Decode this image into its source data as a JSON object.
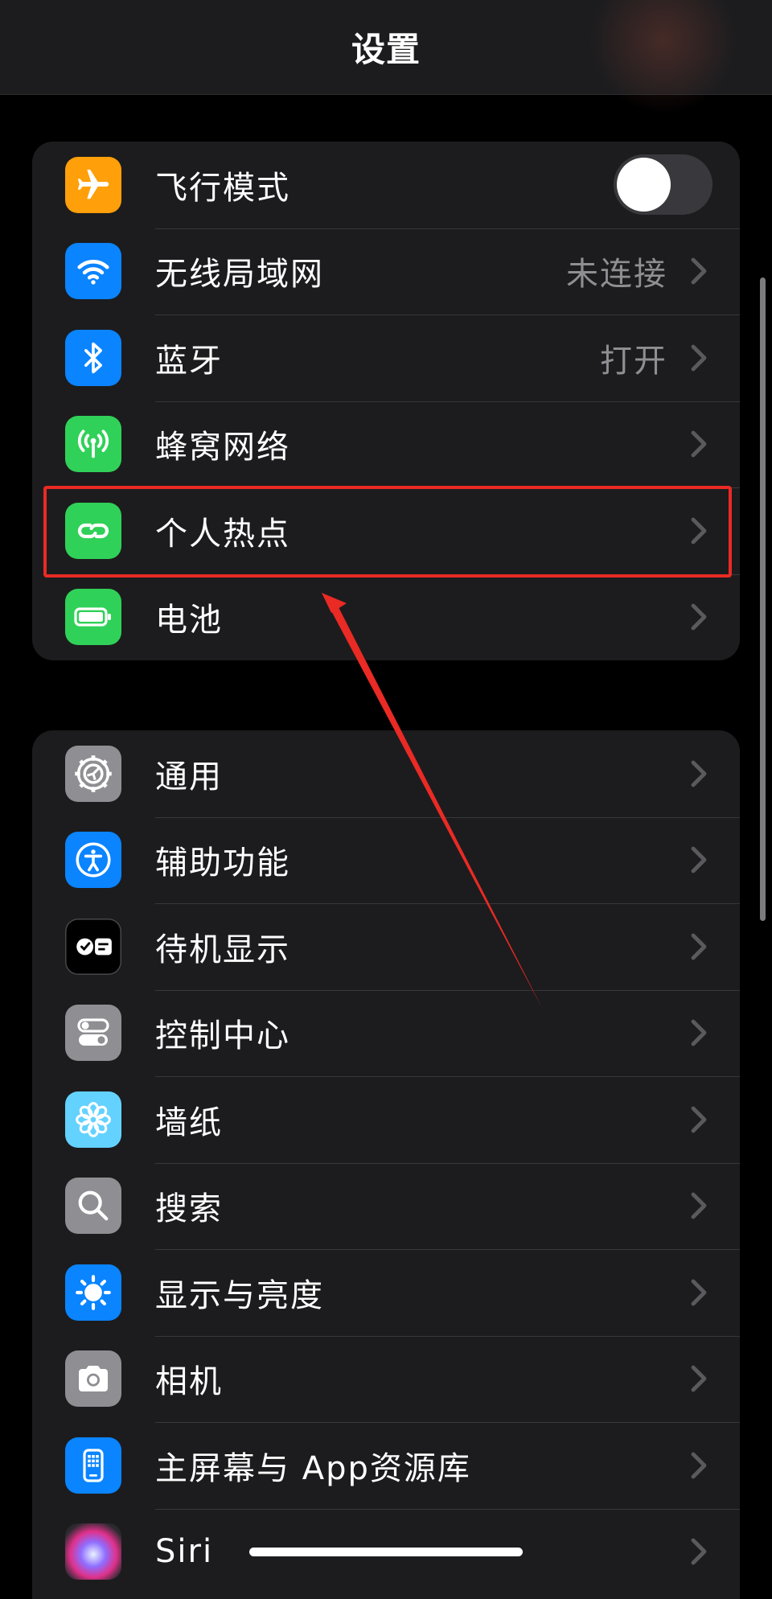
{
  "nav": {
    "title": "设置"
  },
  "groups": {
    "network": [
      {
        "key": "airplane",
        "label": "飞行模式",
        "icon": "airplane-icon",
        "icon_color": "#ff9f0a",
        "control": "toggle",
        "toggle_on": false
      },
      {
        "key": "wifi",
        "label": "无线局域网",
        "detail": "未连接",
        "icon": "wifi-icon",
        "icon_color": "#0a84ff"
      },
      {
        "key": "bluetooth",
        "label": "蓝牙",
        "detail": "打开",
        "icon": "bluetooth-icon",
        "icon_color": "#0a84ff"
      },
      {
        "key": "cellular",
        "label": "蜂窝网络",
        "icon": "antenna-icon",
        "icon_color": "#30d158"
      },
      {
        "key": "hotspot",
        "label": "个人热点",
        "icon": "hotspot-link-icon",
        "icon_color": "#30d158"
      },
      {
        "key": "battery",
        "label": "电池",
        "icon": "battery-icon",
        "icon_color": "#30d158"
      }
    ],
    "system": [
      {
        "key": "general",
        "label": "通用",
        "icon": "gear-icon",
        "icon_color": "#8e8e93"
      },
      {
        "key": "accessibility",
        "label": "辅助功能",
        "icon": "accessibility-icon",
        "icon_color": "#0a84ff"
      },
      {
        "key": "standby",
        "label": "待机显示",
        "icon": "standby-icon",
        "icon_color": "#000000"
      },
      {
        "key": "control_center",
        "label": "控制中心",
        "icon": "toggles-icon",
        "icon_color": "#8e8e93"
      },
      {
        "key": "wallpaper",
        "label": "墙纸",
        "icon": "flower-icon",
        "icon_color": "#64d2ff"
      },
      {
        "key": "search",
        "label": "搜索",
        "icon": "search-icon",
        "icon_color": "#8e8e93"
      },
      {
        "key": "display",
        "label": "显示与亮度",
        "icon": "sun-icon",
        "icon_color": "#0a84ff"
      },
      {
        "key": "camera",
        "label": "相机",
        "icon": "camera-icon",
        "icon_color": "#8e8e93"
      },
      {
        "key": "home_screen",
        "label": "主屏幕与 App资源库",
        "icon": "home-screen-icon",
        "icon_color": "#0a84ff"
      },
      {
        "key": "siri",
        "label": "Siri",
        "icon": "siri-icon",
        "icon_color": "#1c1c1e"
      }
    ]
  },
  "annotation": {
    "highlight_color": "#ea2a24"
  }
}
